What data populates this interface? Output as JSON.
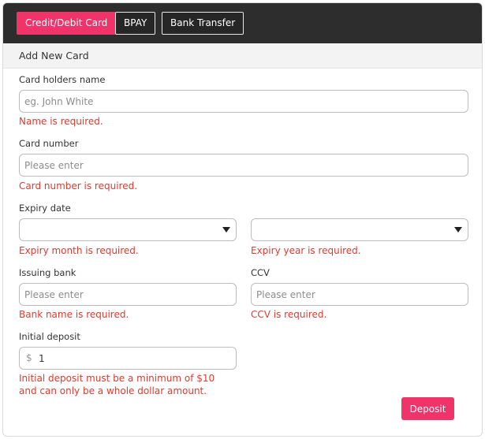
{
  "tabs": [
    {
      "label": "Credit/Debit Card",
      "active": true
    },
    {
      "label": "BPAY",
      "active": false
    },
    {
      "label": "Bank Transfer",
      "active": false
    }
  ],
  "section_title": "Add New Card",
  "form": {
    "card_holder": {
      "label": "Card holders name",
      "placeholder": "eg. John White",
      "value": "",
      "error": "Name is required."
    },
    "card_number": {
      "label": "Card number",
      "placeholder": "Please enter",
      "value": "",
      "error": "Card number is required."
    },
    "expiry": {
      "label": "Expiry date",
      "month_value": "",
      "year_value": "",
      "month_error": "Expiry month is required.",
      "year_error": "Expiry year is required."
    },
    "issuing_bank": {
      "label": "Issuing bank",
      "placeholder": "Please enter",
      "value": "",
      "error": "Bank name is required."
    },
    "ccv": {
      "label": "CCV",
      "placeholder": "Please enter",
      "value": "",
      "error": "CCV is required."
    },
    "initial_deposit": {
      "label": "Initial deposit",
      "currency_symbol": "$",
      "value": "1",
      "error": "Initial deposit must be a minimum of $10 and can only be a whole dollar amount."
    }
  },
  "deposit_button": "Deposit",
  "colors": {
    "accent": "#f0346a",
    "error": "#e03a2e",
    "header": "#2d2d2d"
  }
}
